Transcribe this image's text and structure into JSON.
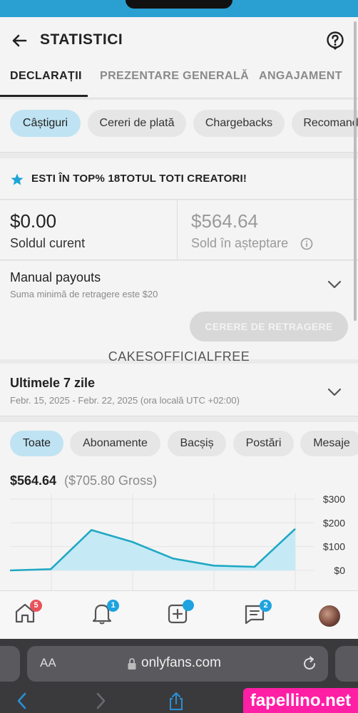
{
  "header": {
    "title": "STATISTICI"
  },
  "tabs": [
    {
      "label": "DECLARAȚII"
    },
    {
      "label": "PREZENTARE GENERALĂ"
    },
    {
      "label": "ANGAJAMENT"
    }
  ],
  "filters": [
    {
      "label": "Câștiguri"
    },
    {
      "label": "Cereri de plată"
    },
    {
      "label": "Chargebacks"
    },
    {
      "label": "Recomand"
    }
  ],
  "banner": {
    "text": "ESTI ÎN TOP% 18TOTUL TOTI CREATORI!"
  },
  "balances": {
    "current_value": "$0.00",
    "current_label": "Soldul curent",
    "pending_value": "$564.64",
    "pending_label": "Sold în așteptare"
  },
  "payouts": {
    "title": "Manual payouts",
    "subtitle": "Suma minimă de retragere este $20",
    "button_label": "CERERE DE RETRAGERE"
  },
  "watermark": {
    "username": "CAKESOFFICIALFREE"
  },
  "period": {
    "title": "Ultimele 7 zile",
    "range": "Febr. 15, 2025 - Febr. 22, 2025 (ora locală UTC +02:00)"
  },
  "earnings_filters": [
    {
      "label": "Toate"
    },
    {
      "label": "Abonamente"
    },
    {
      "label": "Bacșiș"
    },
    {
      "label": "Postări"
    },
    {
      "label": "Mesaje"
    }
  ],
  "totals": {
    "net": "$564.64",
    "gross": "($705.80 Gross)"
  },
  "chart_data": {
    "type": "area",
    "x": [
      1,
      2,
      3,
      4,
      5,
      6,
      7,
      8
    ],
    "series": [
      {
        "values": [
          0,
          5,
          170,
          120,
          50,
          20,
          15,
          175
        ]
      }
    ],
    "ylim": [
      0,
      300
    ],
    "ytick_labels": [
      "$300",
      "$200",
      "$100",
      "$0"
    ],
    "ytick_values": [
      300,
      200,
      100,
      0
    ],
    "grid": true,
    "color": "#20a8c4",
    "fill": "#c5eaf5"
  },
  "bottom_nav": [
    {
      "icon": "home-icon",
      "badge": "5",
      "badge_color": "#e8525a"
    },
    {
      "icon": "bell-icon",
      "badge": "1",
      "badge_color": "#1fa3e0"
    },
    {
      "icon": "add-post-icon",
      "badge": "",
      "badge_color": "#1fa3e0"
    },
    {
      "icon": "messages-icon",
      "badge": "2",
      "badge_color": "#1fa3e0"
    },
    {
      "icon": "avatar"
    }
  ],
  "browser": {
    "aa_label": "AA",
    "url": "onlyfans.com"
  },
  "site_badge": {
    "text": "fapellino.net"
  },
  "colors": {
    "accent": "#2a9fd2",
    "chip_active": "#bfe3f2",
    "badge_pink": "#ff1fa5"
  }
}
